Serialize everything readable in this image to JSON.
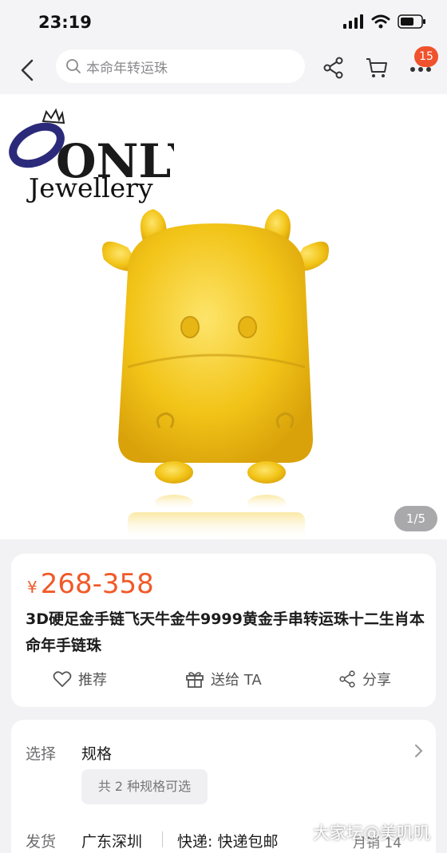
{
  "status_bar": {
    "time": "23:19"
  },
  "nav": {
    "search_placeholder": "本命年转运珠",
    "cart_badge": "15",
    "icons": [
      "back-arrow-icon",
      "search-icon",
      "share-icon",
      "cart-icon",
      "more-icon"
    ]
  },
  "hero": {
    "brand_mark": "ONLY",
    "brand_sub": "Jewellery",
    "page_indicator": "1/5"
  },
  "product": {
    "price_symbol": "¥",
    "price_range": "268-358",
    "title": "3D硬足金手链飞天牛金牛9999黄金手串转运珠十二生肖本命年手链珠",
    "actions": [
      {
        "icon": "heart-icon",
        "label": "推荐"
      },
      {
        "icon": "gift-icon",
        "label": "送给 TA"
      },
      {
        "icon": "share-icon",
        "label": "分享"
      }
    ]
  },
  "specs": {
    "select_label": "选择",
    "select_value": "规格",
    "spec_chip": "共 2 种规格可选",
    "ship_label": "发货",
    "ship_from": "广东深圳",
    "ship_method": "快递: 快递包邮",
    "monthly_sales": "月销 14"
  },
  "watermark": "大家坛@美叽叽",
  "colors": {
    "accent": "#f05a28",
    "badge": "#f0522d",
    "gold": "#f2c418"
  }
}
